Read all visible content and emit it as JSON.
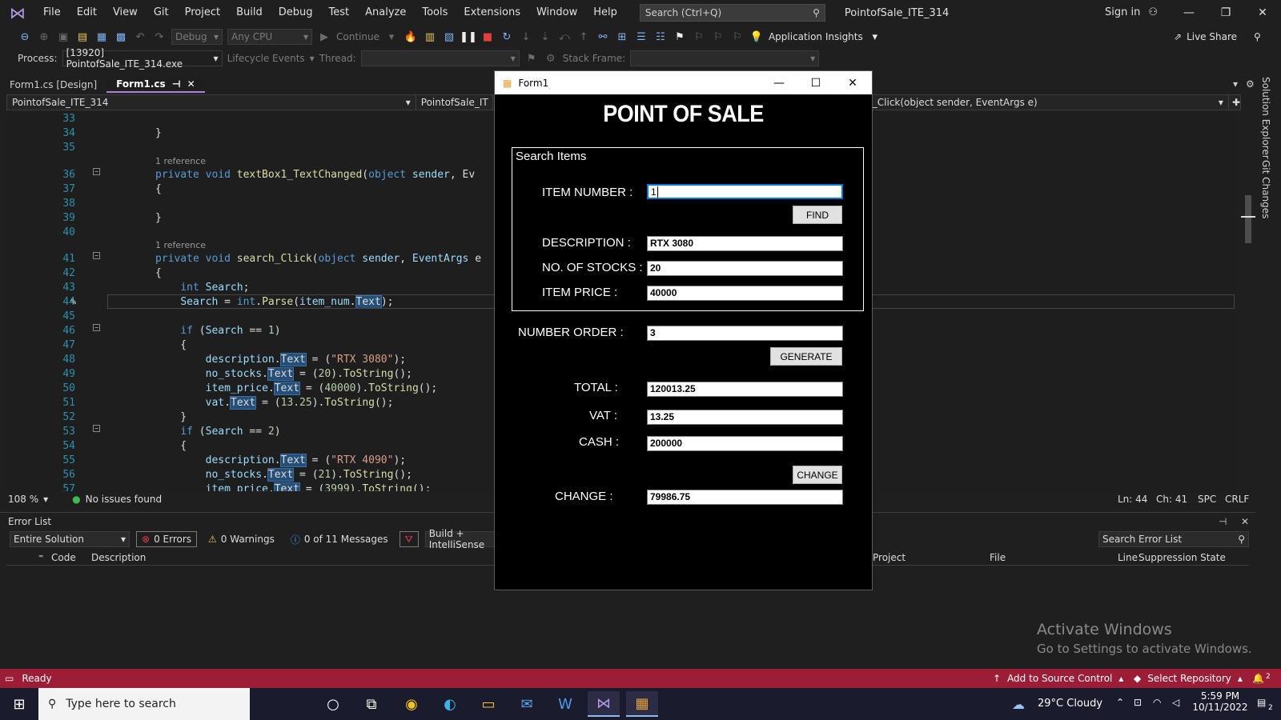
{
  "ide": {
    "menu": [
      "File",
      "Edit",
      "View",
      "Git",
      "Project",
      "Build",
      "Debug",
      "Test",
      "Analyze",
      "Tools",
      "Extensions",
      "Window",
      "Help"
    ],
    "search_placeholder": "Search (Ctrl+Q)",
    "solution_title": "PointofSale_ITE_314",
    "sign_in": "Sign in",
    "toolbar": {
      "config": "Debug",
      "platform": "Any CPU",
      "continue_label": "Continue",
      "app_insights": "Application Insights",
      "live_share": "Live Share"
    },
    "debug_bar": {
      "process_label": "Process:",
      "process_value": "[13920] PointofSale_ITE_314.exe",
      "lifecycle": "Lifecycle Events",
      "thread_label": "Thread:",
      "stack_label": "Stack Frame:"
    },
    "tabs": [
      {
        "label": "Form1.cs [Design]"
      },
      {
        "label": "Form1.cs"
      }
    ],
    "nav": {
      "project": "PointofSale_ITE_314",
      "class": "PointofSale_IT",
      "member": "_Click(object sender, EventArgs e)"
    },
    "codelens": "1 reference",
    "editor_status": {
      "zoom": "108 %",
      "issues": "No issues found",
      "ln": "Ln: 44",
      "ch": "Ch: 41",
      "spc": "SPC",
      "crlf": "CRLF"
    },
    "side_tabs": [
      "Solution Explorer",
      "Git Changes"
    ],
    "error_list": {
      "title": "Error List",
      "scope": "Entire Solution",
      "errors": "0 Errors",
      "warnings": "0 Warnings",
      "messages": "0 of 11 Messages",
      "build_filter": "Build + IntelliSense",
      "search_placeholder": "Search Error List",
      "columns": [
        "Code",
        "Description",
        "Project",
        "File",
        "Line",
        "Suppression State"
      ]
    },
    "watermark": {
      "line1": "Activate Windows",
      "line2": "Go to Settings to activate Windows."
    },
    "status": {
      "ready": "Ready",
      "source_control": "Add to Source Control",
      "repository": "Select Repository",
      "notifications": "2"
    }
  },
  "taskbar": {
    "search_placeholder": "Type here to search",
    "weather": "29°C  Cloudy",
    "time": "5:59 PM",
    "date": "10/11/2022",
    "notification_count": "2"
  },
  "form": {
    "title": "Form1",
    "heading": "POINT OF SALE",
    "group_label": "Search Items",
    "item_number_label": "ITEM NUMBER :",
    "item_number_value": "1",
    "find_button": "FIND",
    "description_label": "DESCRIPTION :",
    "description_value": "RTX 3080",
    "stocks_label": "NO. OF STOCKS :",
    "stocks_value": "20",
    "price_label": "ITEM PRICE :",
    "price_value": "40000",
    "order_label": "NUMBER ORDER :",
    "order_value": "3",
    "generate_button": "GENERATE",
    "total_label": "TOTAL :",
    "total_value": "120013.25",
    "vat_label": "VAT :",
    "vat_value": "13.25",
    "cash_label": "CASH :",
    "cash_value": "200000",
    "change_button": "CHANGE",
    "change_label": "CHANGE :",
    "change_value": "79986.75"
  },
  "colors": {
    "accent": "#b180d7",
    "status_bar": "#9b1d36",
    "keyword": "#569cd6",
    "line_number": "#2b91af"
  }
}
